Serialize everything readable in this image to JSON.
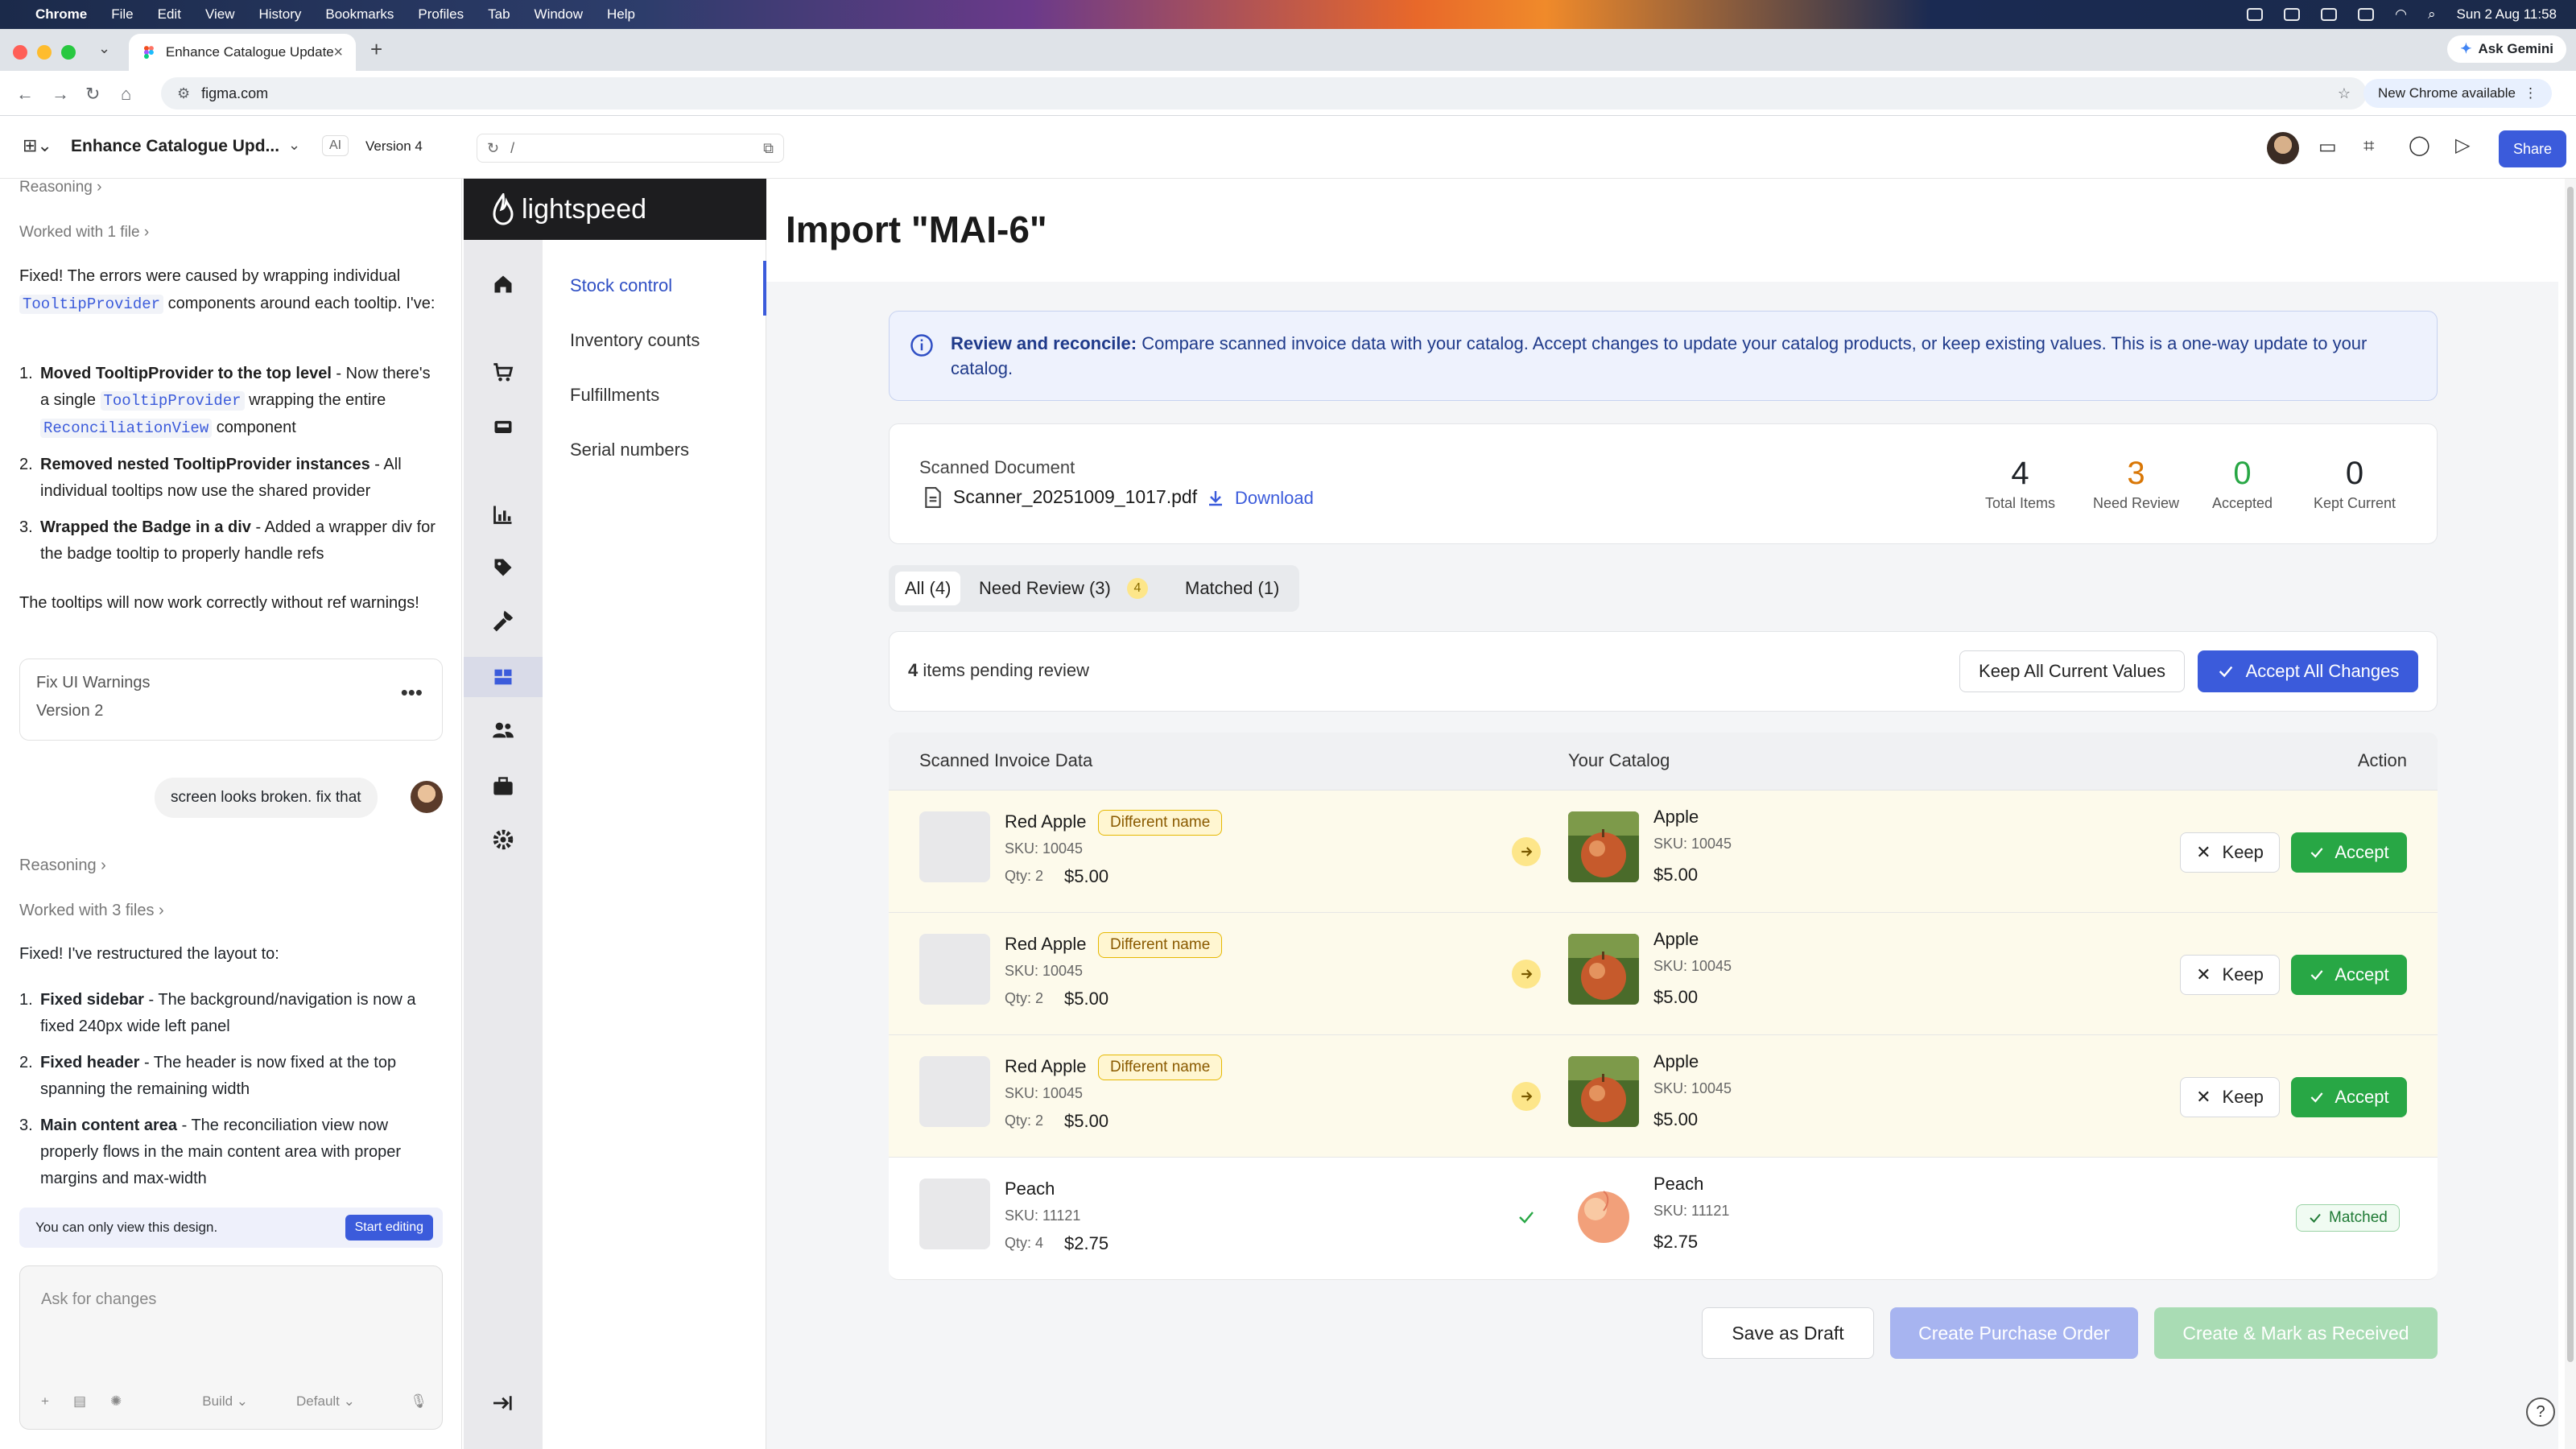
{
  "menubar": {
    "app": "Chrome",
    "items": [
      "File",
      "Edit",
      "View",
      "History",
      "Bookmarks",
      "Profiles",
      "Tab",
      "Window",
      "Help"
    ],
    "datetime": "Sun 2 Aug  11:58"
  },
  "browser": {
    "tab_title": "Enhance Catalogue Update U",
    "url": "figma.com",
    "ask_gemini": "Ask Gemini",
    "new_chrome": "New Chrome available"
  },
  "figma": {
    "file_title": "Enhance Catalogue Upd...",
    "ai_chip": "AI",
    "version": "Version 4",
    "preview_path": "/",
    "share": "Share"
  },
  "chat": {
    "reasoning1": "Reasoning",
    "worked1": "Worked with 1 file",
    "intro1_a": "Fixed! The errors were caused by wrapping individual",
    "intro1_code": "TooltipProvider",
    "intro1_b": "components around each tooltip. I've:",
    "list1": [
      {
        "n": "1.",
        "bold": "Moved TooltipProvider to the top level",
        "text_a": " - Now there's a single ",
        "code": "TooltipProvider",
        "text_b": " wrapping the entire ",
        "code2": "ReconciliationView",
        "text_c": " component"
      },
      {
        "n": "2.",
        "bold": "Removed nested TooltipProvider instances",
        "text_a": " - All individual tooltips now use the shared provider"
      },
      {
        "n": "3.",
        "bold": "Wrapped the Badge in a div",
        "text_a": " - Added a wrapper div for the badge tooltip to properly handle refs"
      }
    ],
    "outro1": "The tooltips will now work correctly without ref warnings!",
    "card_title": "Fix UI Warnings",
    "card_version": "Version 2",
    "user_msg": "screen looks broken. fix that",
    "reasoning2": "Reasoning",
    "worked2": "Worked with 3 files",
    "intro2": "Fixed! I've restructured the layout to:",
    "list2": [
      {
        "n": "1.",
        "bold": "Fixed sidebar",
        "text_a": " - The background/navigation is now a fixed 240px wide left panel"
      },
      {
        "n": "2.",
        "bold": "Fixed header",
        "text_a": " - The header is now fixed at the top spanning the remaining width"
      },
      {
        "n": "3.",
        "bold": "Main content area",
        "text_a": " - The reconciliation view now properly flows in the main content area with proper margins and max-width"
      }
    ],
    "view_only": "You can only view this design.",
    "start_editing": "Start editing",
    "ask_placeholder": "Ask for changes",
    "build": "Build",
    "default": "Default"
  },
  "app": {
    "logo": "lightspeed",
    "subnav": [
      "Stock control",
      "Inventory counts",
      "Fulfillments",
      "Serial numbers"
    ],
    "page_title": "Import \"MAI-6\"",
    "info_bold": "Review and reconcile:",
    "info_text": " Compare scanned invoice data with your catalog. Accept changes to update your catalog products, or keep existing values. This is a one-way update to your catalog.",
    "doc_label": "Scanned Document",
    "doc_file": "Scanner_20251009_1017.pdf",
    "download": "Download",
    "stats": [
      {
        "num": "4",
        "label": "Total Items",
        "color": "#1a1a1a"
      },
      {
        "num": "3",
        "label": "Need Review",
        "color": "#d97706"
      },
      {
        "num": "0",
        "label": "Accepted",
        "color": "#28a745"
      },
      {
        "num": "0",
        "label": "Kept Current",
        "color": "#1a1a1a"
      }
    ],
    "tabs": [
      "All (4)",
      "Need Review (3)",
      "Matched (1)"
    ],
    "tab_badge": "4",
    "pending_count": "4",
    "pending_text": " items pending review",
    "keep_all": "Keep All Current Values",
    "accept_all": "Accept All Changes",
    "col_scanned": "Scanned Invoice Data",
    "col_catalog": "Your Catalog",
    "col_action": "Action",
    "rows": [
      {
        "name": "Red Apple",
        "badge": "Different name",
        "sku": "SKU: 10045",
        "qty": "Qty: 2",
        "price": "$5.00",
        "c_name": "Apple",
        "c_sku": "SKU: 10045",
        "c_price": "$5.00",
        "keep": "Keep",
        "accept": "Accept"
      },
      {
        "name": "Red Apple",
        "badge": "Different name",
        "sku": "SKU: 10045",
        "qty": "Qty: 2",
        "price": "$5.00",
        "c_name": "Apple",
        "c_sku": "SKU: 10045",
        "c_price": "$5.00",
        "keep": "Keep",
        "accept": "Accept"
      },
      {
        "name": "Red Apple",
        "badge": "Different name",
        "sku": "SKU: 10045",
        "qty": "Qty: 2",
        "price": "$5.00",
        "c_name": "Apple",
        "c_sku": "SKU: 10045",
        "c_price": "$5.00",
        "keep": "Keep",
        "accept": "Accept"
      },
      {
        "name": "Peach",
        "sku": "SKU: 11121",
        "qty": "Qty: 4",
        "price": "$2.75",
        "c_name": "Peach",
        "c_sku": "SKU: 11121",
        "c_price": "$2.75",
        "matched": "Matched"
      }
    ],
    "save_draft": "Save as Draft",
    "create_po": "Create Purchase Order",
    "create_received": "Create & Mark as Received",
    "help": "?"
  },
  "colors": {
    "accent": "#3b5bdb",
    "success": "#28a745",
    "warning": "#d97706"
  }
}
